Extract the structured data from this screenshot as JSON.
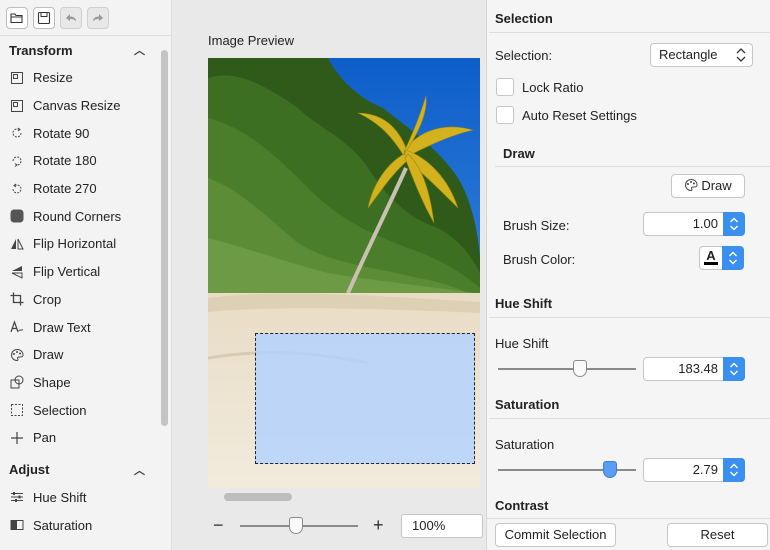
{
  "toolbar": {
    "buttons": [
      {
        "name": "open-folder",
        "icon": "folder-open-icon"
      },
      {
        "name": "save",
        "icon": "save-icon"
      },
      {
        "name": "undo",
        "icon": "undo-icon"
      },
      {
        "name": "redo",
        "icon": "redo-icon"
      }
    ]
  },
  "sidebar": {
    "sections": [
      {
        "title": "Transform",
        "items": [
          {
            "label": "Resize",
            "icon": "resize-icon"
          },
          {
            "label": "Canvas Resize",
            "icon": "canvas-resize-icon"
          },
          {
            "label": "Rotate 90",
            "icon": "rotate-90-icon"
          },
          {
            "label": "Rotate 180",
            "icon": "rotate-180-icon"
          },
          {
            "label": "Rotate 270",
            "icon": "rotate-270-icon"
          },
          {
            "label": "Round Corners",
            "icon": "round-corners-icon"
          },
          {
            "label": "Flip Horizontal",
            "icon": "flip-horizontal-icon"
          },
          {
            "label": "Flip Vertical",
            "icon": "flip-vertical-icon"
          },
          {
            "label": "Crop",
            "icon": "crop-icon"
          },
          {
            "label": "Draw Text",
            "icon": "draw-text-icon"
          },
          {
            "label": "Draw",
            "icon": "palette-icon"
          },
          {
            "label": "Shape",
            "icon": "shape-icon"
          },
          {
            "label": "Selection",
            "icon": "selection-icon"
          },
          {
            "label": "Pan",
            "icon": "pan-icon"
          }
        ]
      },
      {
        "title": "Adjust",
        "items": [
          {
            "label": "Hue Shift",
            "icon": "sliders-icon"
          },
          {
            "label": "Saturation",
            "icon": "saturation-icon"
          }
        ]
      }
    ]
  },
  "preview": {
    "label": "Image Preview",
    "zoom_value": "100%",
    "zoom_minus": "−",
    "zoom_plus": "+"
  },
  "panel": {
    "selection": {
      "title": "Selection",
      "selection_label": "Selection:",
      "selection_value": "Rectangle",
      "lock_ratio_label": "Lock Ratio",
      "auto_reset_label": "Auto Reset Settings"
    },
    "draw": {
      "title": "Draw",
      "draw_button": "Draw",
      "brush_size_label": "Brush Size:",
      "brush_size_value": "1.00",
      "brush_color_label": "Brush Color:",
      "brush_color_glyph": "A"
    },
    "hue_shift": {
      "title": "Hue Shift",
      "label": "Hue Shift",
      "value": "183.48"
    },
    "saturation": {
      "title": "Saturation",
      "label": "Saturation",
      "value": "2.79"
    },
    "contrast": {
      "title": "Contrast"
    },
    "commit_button": "Commit Selection",
    "reset_button": "Reset"
  },
  "colors": {
    "accent": "#3a8ff0",
    "selection_fill": "#b2d2ff"
  }
}
